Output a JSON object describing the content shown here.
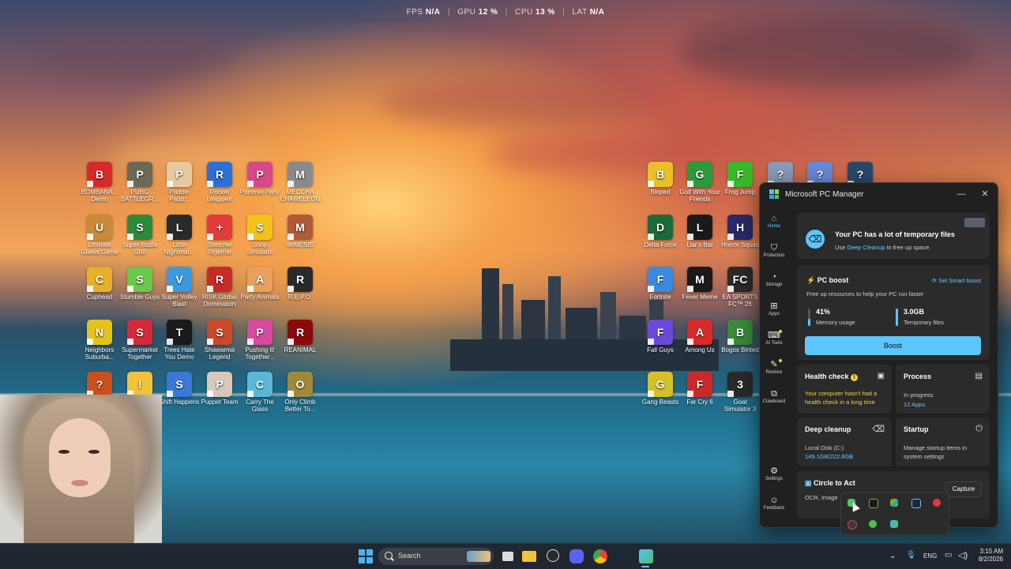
{
  "hud": {
    "fps_label": "FPS",
    "fps_value": "N/A",
    "gpu_label": "GPU",
    "gpu_value": "12 %",
    "cpu_label": "CPU",
    "cpu_value": "13 %",
    "lat_label": "LAT",
    "lat_value": "N/A",
    "separator": "|"
  },
  "desktop_icons": [
    {
      "label": "BOMBANA... Demo",
      "color": "#d62a2a",
      "glyph": "B"
    },
    {
      "label": "PUBG BATTLEGR...",
      "color": "#6a6a55",
      "glyph": "P"
    },
    {
      "label": "Paddle Padd...",
      "color": "#e6c9a0",
      "glyph": "P"
    },
    {
      "label": "Rocket League®",
      "color": "#2c6fd6",
      "glyph": "R"
    },
    {
      "label": "Pummel Party",
      "color": "#d64a8a",
      "glyph": "P"
    },
    {
      "label": "MECCHA CHAMELEON",
      "color": "#8a8a8a",
      "glyph": "M"
    },
    {
      "label": "Ultimate Guess Game",
      "color": "#c98a3a",
      "glyph": "U"
    },
    {
      "label": "Super Battle Golf",
      "color": "#2c8a3a",
      "glyph": "S"
    },
    {
      "label": "Little Nightmar...",
      "color": "#2a2a2a",
      "glyph": "L"
    },
    {
      "label": "Stretcher Together",
      "color": "#e03a3a",
      "glyph": "+"
    },
    {
      "label": "Shop Simulator",
      "color": "#f2c21a",
      "glyph": "$"
    },
    {
      "label": "MIMESIS",
      "color": "#b05a3a",
      "glyph": "M"
    },
    {
      "label": "Cuphead",
      "color": "#e6b02a",
      "glyph": "C"
    },
    {
      "label": "Stumble Guys",
      "color": "#6ac84a",
      "glyph": "S"
    },
    {
      "label": "Super Volley Blast",
      "color": "#3a9ae0",
      "glyph": "V"
    },
    {
      "label": "RISK Global Domination",
      "color": "#c82a2a",
      "glyph": "R"
    },
    {
      "label": "Party Animals",
      "color": "#e8a05a",
      "glyph": "A"
    },
    {
      "label": "R.E.P.O.",
      "color": "#2a2a2a",
      "glyph": "R"
    },
    {
      "label": "Neighbors Suburba...",
      "color": "#e6c21a",
      "glyph": "N"
    },
    {
      "label": "Supermarket Together",
      "color": "#d62a3a",
      "glyph": "S"
    },
    {
      "label": "Trees Hate You Demo",
      "color": "#1a1a1a",
      "glyph": "T"
    },
    {
      "label": "Shawarma Legend",
      "color": "#c84a2a",
      "glyph": "S"
    },
    {
      "label": "Pushing it! Together...",
      "color": "#d64aa0",
      "glyph": "P"
    },
    {
      "label": "REANIMAL",
      "color": "#8a0a0a",
      "glyph": "R"
    },
    {
      "label": "",
      "color": "#c8501a",
      "glyph": "?"
    },
    {
      "label": "",
      "color": "#f2c23a",
      "glyph": "!"
    },
    {
      "label": "Shift Happens",
      "color": "#3a7ad6",
      "glyph": "S"
    },
    {
      "label": "Puppet Team",
      "color": "#d8c8b8",
      "glyph": "P"
    },
    {
      "label": "Carry The Glass",
      "color": "#5ab8d6",
      "glyph": "C"
    },
    {
      "label": "Only Climb Better To...",
      "color": "#a08a3a",
      "glyph": "O"
    },
    {
      "label": "Bloped",
      "color": "#e8c02a",
      "glyph": "B"
    },
    {
      "label": "Golf With Your Friends",
      "color": "#2c9a3a",
      "glyph": "G"
    },
    {
      "label": "Frog Jump",
      "color": "#3ab82a",
      "glyph": "F"
    },
    {
      "label": "",
      "color": "#8a9ab8",
      "glyph": "?"
    },
    {
      "label": "",
      "color": "#6a8ad6",
      "glyph": "?"
    },
    {
      "label": "",
      "color": "#2a4a6a",
      "glyph": "?"
    },
    {
      "label": "Delta Force",
      "color": "#1a6a3a",
      "glyph": "D"
    },
    {
      "label": "Liar's Bar",
      "color": "#1a1a1a",
      "glyph": "L"
    },
    {
      "label": "Horror Squad",
      "color": "#2a2a6a",
      "glyph": "H"
    },
    {
      "label": "Fortnite",
      "color": "#3a8ae0",
      "glyph": "F"
    },
    {
      "label": "Fever Meme",
      "color": "#1a1a1a",
      "glyph": "M"
    },
    {
      "label": "EA SPORTS FC™ 26",
      "color": "#2a2a2a",
      "glyph": "FC"
    },
    {
      "label": "Fall Guys",
      "color": "#6a4ad6",
      "glyph": "F"
    },
    {
      "label": "Among Us",
      "color": "#d62a2a",
      "glyph": "A"
    },
    {
      "label": "Bogos Binted",
      "color": "#3a8a3a",
      "glyph": "B"
    },
    {
      "label": "Gang Beasts",
      "color": "#d6c02a",
      "glyph": "G"
    },
    {
      "label": "Far Cry 6",
      "color": "#c82a2a",
      "glyph": "F"
    },
    {
      "label": "Goat Simulator 3",
      "color": "#2a2a2a",
      "glyph": "3"
    }
  ],
  "pc_manager": {
    "title": "Microsoft PC Manager",
    "minimize": "—",
    "close": "✕",
    "nav": [
      {
        "label": "Home",
        "glyph": "⌂",
        "active": true
      },
      {
        "label": "Protection",
        "glyph": "⛉",
        "active": false
      },
      {
        "label": "Storage",
        "glyph": "◔",
        "active": false
      },
      {
        "label": "Apps",
        "glyph": "⊞",
        "active": false
      },
      {
        "label": "AI Tools",
        "glyph": "⌨",
        "active": false
      },
      {
        "label": "Restore",
        "glyph": "✎",
        "active": false
      },
      {
        "label": "Clawboard",
        "glyph": "⧉",
        "active": false
      }
    ],
    "nav_bottom": [
      {
        "label": "Settings",
        "glyph": "⚙"
      },
      {
        "label": "Feedback",
        "glyph": "☺"
      }
    ],
    "banner": {
      "title": "Your PC has a lot of temporary files",
      "sub_prefix": "Use ",
      "sub_link": "Deep Cleanup",
      "sub_suffix": " to free up space."
    },
    "boost": {
      "title": "PC boost",
      "smart_link": "Set Smart boost",
      "sub": "Free up resources to help your PC run faster",
      "memory_value": "41%",
      "memory_label": "Memory usage",
      "temp_value": "3.0GB",
      "temp_label": "Temporary files",
      "button": "Boost"
    },
    "health": {
      "title": "Health check",
      "text": "Your computer hasn't had a health check in a long time"
    },
    "process": {
      "title": "Process",
      "line1": "In progress",
      "line2": "12 Apps"
    },
    "deep_cleanup": {
      "title": "Deep cleanup",
      "line1": "Local Disk (C:)",
      "line2": "149.1GB/222.6GB"
    },
    "startup": {
      "title": "Startup",
      "text": "Manage startup items in system settings"
    },
    "circle": {
      "title": "Circle to Act",
      "sub": "OCR, Image"
    },
    "capture": "Capture"
  },
  "taskbar": {
    "search_placeholder": "Search",
    "lang": "ENG",
    "time": "3:15 AM",
    "date": "8/2/2026"
  },
  "colors": {
    "accent": "#5cc6fb",
    "warning": "#f2d33a",
    "panel": "#202020",
    "card": "#2b2b2b"
  }
}
